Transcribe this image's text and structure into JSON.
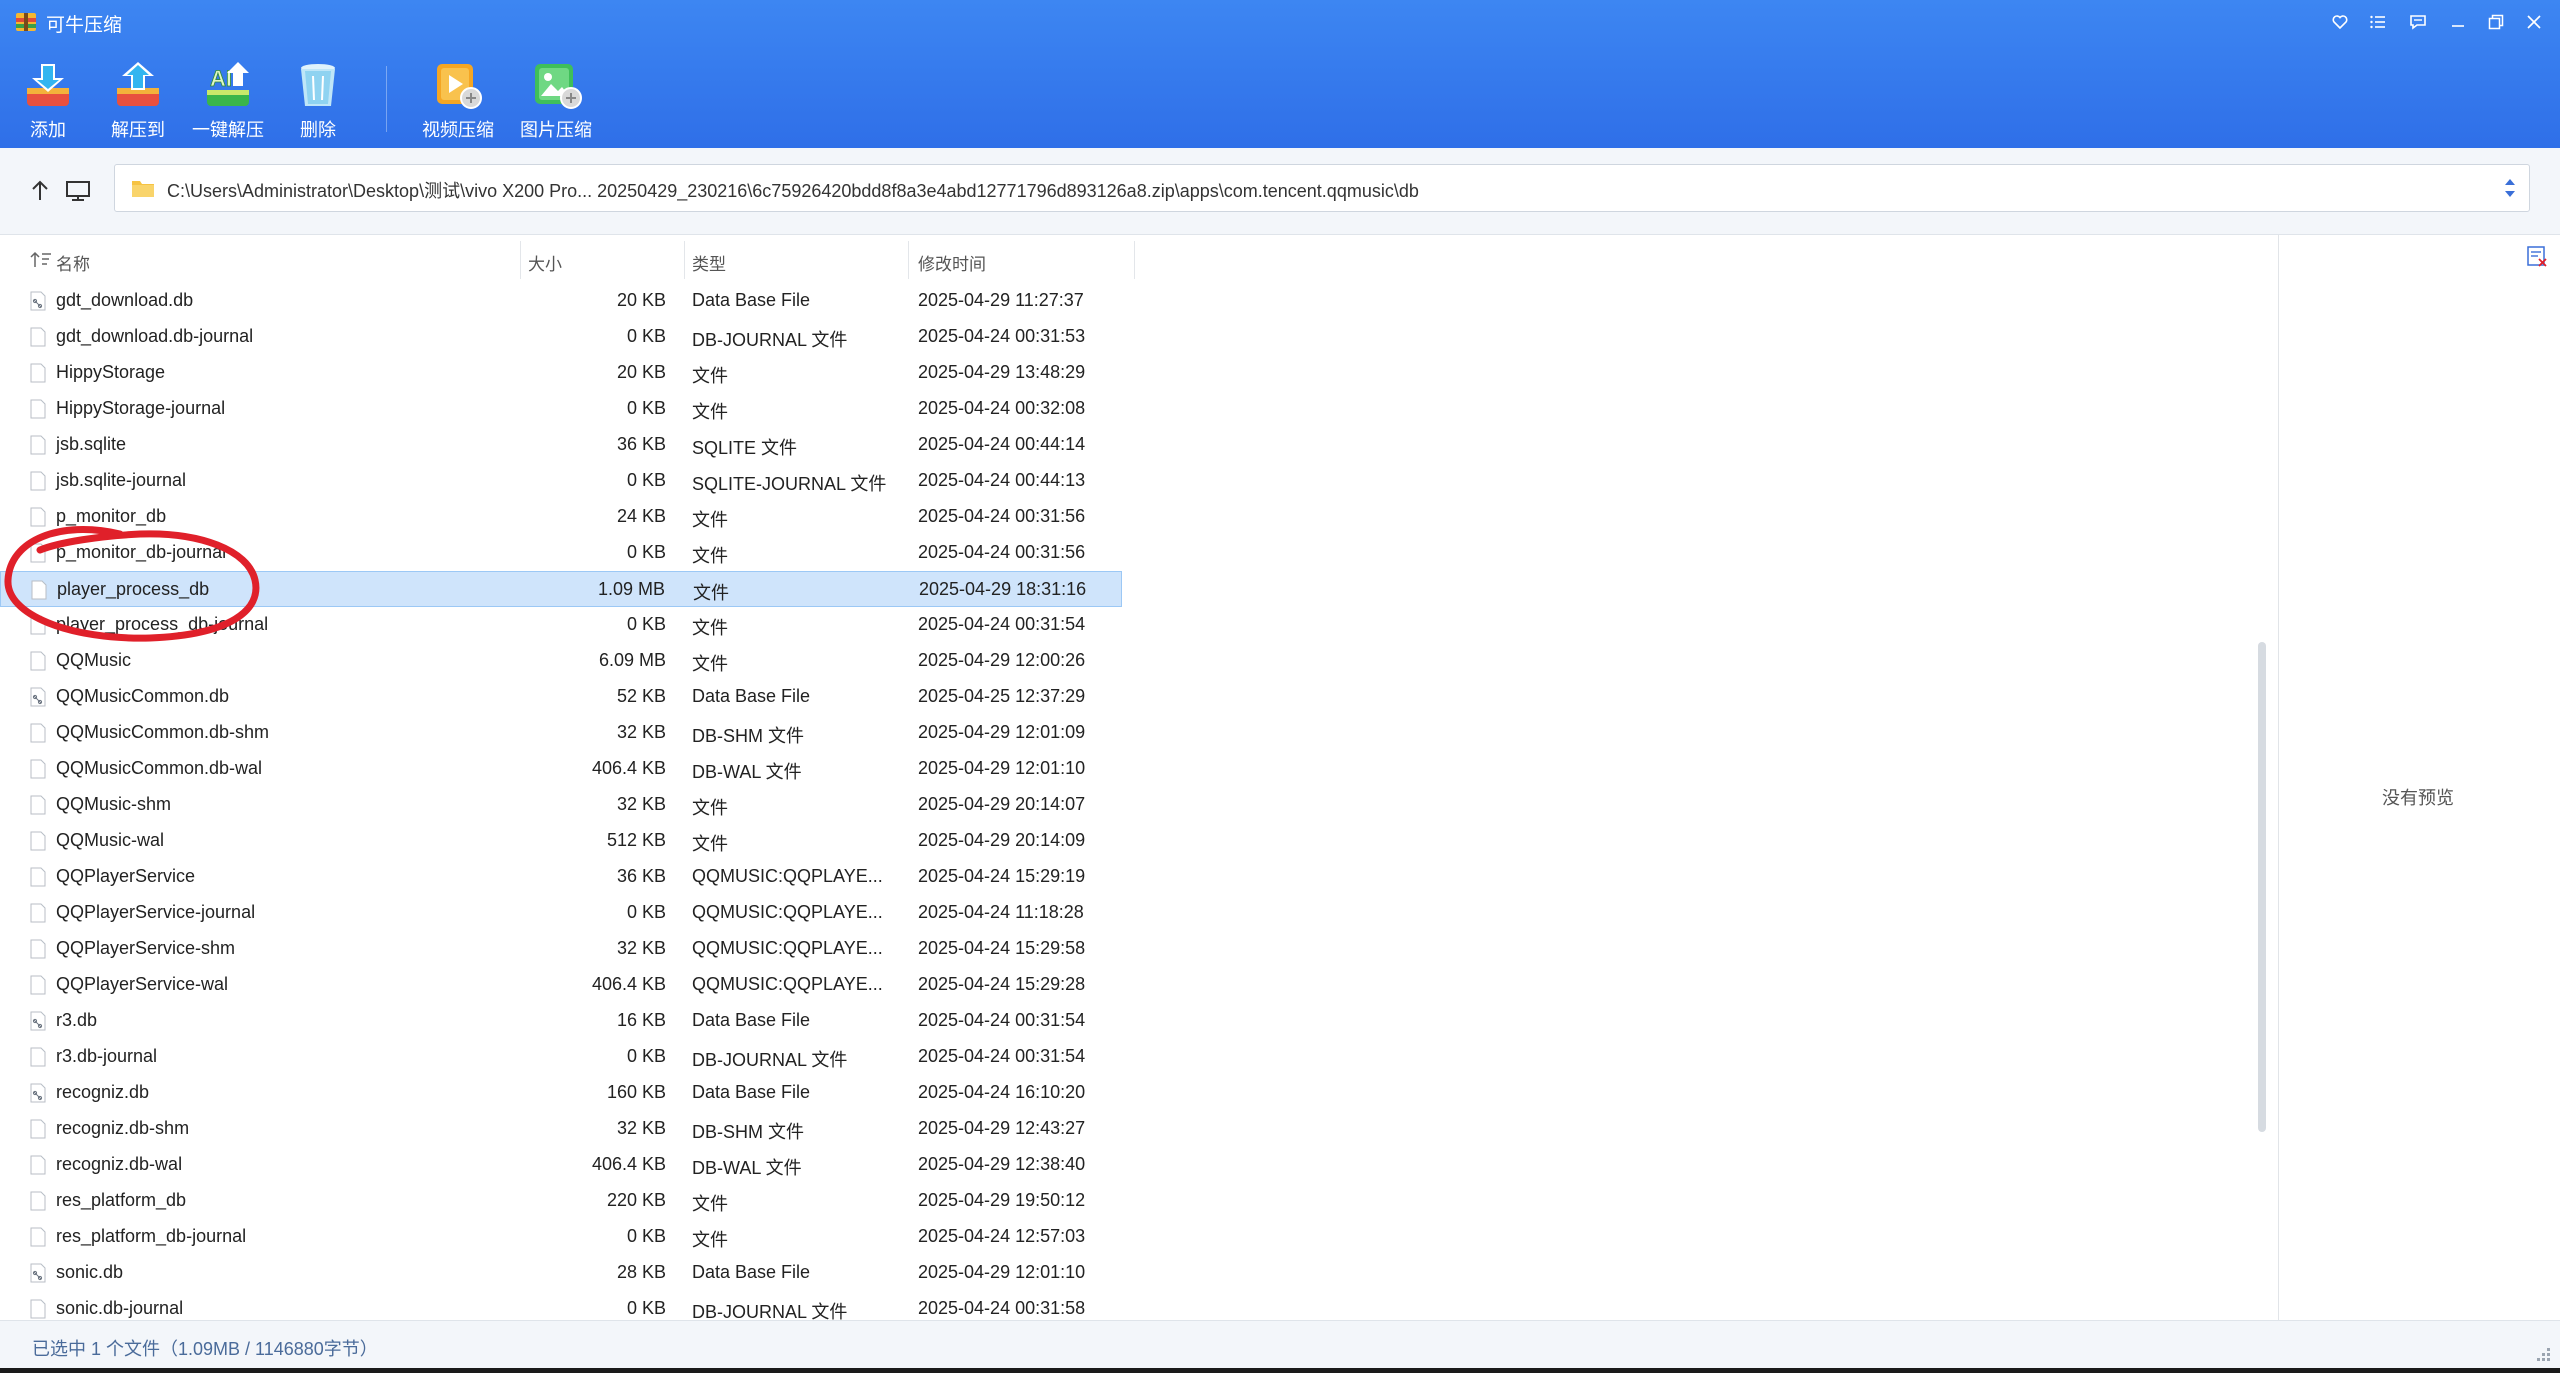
{
  "window": {
    "title": "可牛压缩"
  },
  "toolbar": {
    "buttons": [
      {
        "label": "添加",
        "icon": "add-icon"
      },
      {
        "label": "解压到",
        "icon": "extract-to-icon"
      },
      {
        "label": "一键解压",
        "icon": "one-click-extract-icon"
      },
      {
        "label": "删除",
        "icon": "delete-icon"
      },
      {
        "label": "视频压缩",
        "icon": "video-compress-icon"
      },
      {
        "label": "图片压缩",
        "icon": "image-compress-icon"
      }
    ]
  },
  "address": {
    "path": "C:\\Users\\Administrator\\Desktop\\测试\\vivo X200 Pro... 20250429_230216\\6c75926420bdd8f8a3e4abd12771796d893126a8.zip\\apps\\com.tencent.qqmusic\\db"
  },
  "columns": {
    "name": "名称",
    "size": "大小",
    "type": "类型",
    "modified": "修改时间"
  },
  "files": [
    {
      "name": "gdt_download.db",
      "size": "20 KB",
      "type": "Data Base File",
      "modified": "2025-04-29 11:27:37",
      "db": true
    },
    {
      "name": "gdt_download.db-journal",
      "size": "0 KB",
      "type": "DB-JOURNAL 文件",
      "modified": "2025-04-24 00:31:53"
    },
    {
      "name": "HippyStorage",
      "size": "20 KB",
      "type": "文件",
      "modified": "2025-04-29 13:48:29"
    },
    {
      "name": "HippyStorage-journal",
      "size": "0 KB",
      "type": "文件",
      "modified": "2025-04-24 00:32:08"
    },
    {
      "name": "jsb.sqlite",
      "size": "36 KB",
      "type": "SQLITE 文件",
      "modified": "2025-04-24 00:44:14"
    },
    {
      "name": "jsb.sqlite-journal",
      "size": "0 KB",
      "type": "SQLITE-JOURNAL 文件",
      "modified": "2025-04-24 00:44:13"
    },
    {
      "name": "p_monitor_db",
      "size": "24 KB",
      "type": "文件",
      "modified": "2025-04-24 00:31:56"
    },
    {
      "name": "p_monitor_db-journal",
      "size": "0 KB",
      "type": "文件",
      "modified": "2025-04-24 00:31:56"
    },
    {
      "name": "player_process_db",
      "size": "1.09 MB",
      "type": "文件",
      "modified": "2025-04-29 18:31:16",
      "selected": true
    },
    {
      "name": "player_process_db-journal",
      "size": "0 KB",
      "type": "文件",
      "modified": "2025-04-24 00:31:54"
    },
    {
      "name": "QQMusic",
      "size": "6.09 MB",
      "type": "文件",
      "modified": "2025-04-29 12:00:26"
    },
    {
      "name": "QQMusicCommon.db",
      "size": "52 KB",
      "type": "Data Base File",
      "modified": "2025-04-25 12:37:29",
      "db": true
    },
    {
      "name": "QQMusicCommon.db-shm",
      "size": "32 KB",
      "type": "DB-SHM 文件",
      "modified": "2025-04-29 12:01:09"
    },
    {
      "name": "QQMusicCommon.db-wal",
      "size": "406.4 KB",
      "type": "DB-WAL 文件",
      "modified": "2025-04-29 12:01:10"
    },
    {
      "name": "QQMusic-shm",
      "size": "32 KB",
      "type": "文件",
      "modified": "2025-04-29 20:14:07"
    },
    {
      "name": "QQMusic-wal",
      "size": "512 KB",
      "type": "文件",
      "modified": "2025-04-29 20:14:09"
    },
    {
      "name": "QQPlayerService",
      "size": "36 KB",
      "type": "QQMUSIC:QQPLAYE...",
      "modified": "2025-04-24 15:29:19"
    },
    {
      "name": "QQPlayerService-journal",
      "size": "0 KB",
      "type": "QQMUSIC:QQPLAYE...",
      "modified": "2025-04-24 11:18:28"
    },
    {
      "name": "QQPlayerService-shm",
      "size": "32 KB",
      "type": "QQMUSIC:QQPLAYE...",
      "modified": "2025-04-24 15:29:58"
    },
    {
      "name": "QQPlayerService-wal",
      "size": "406.4 KB",
      "type": "QQMUSIC:QQPLAYE...",
      "modified": "2025-04-24 15:29:28"
    },
    {
      "name": "r3.db",
      "size": "16 KB",
      "type": "Data Base File",
      "modified": "2025-04-24 00:31:54",
      "db": true
    },
    {
      "name": "r3.db-journal",
      "size": "0 KB",
      "type": "DB-JOURNAL 文件",
      "modified": "2025-04-24 00:31:54"
    },
    {
      "name": "recogniz.db",
      "size": "160 KB",
      "type": "Data Base File",
      "modified": "2025-04-24 16:10:20",
      "db": true
    },
    {
      "name": "recogniz.db-shm",
      "size": "32 KB",
      "type": "DB-SHM 文件",
      "modified": "2025-04-29 12:43:27"
    },
    {
      "name": "recogniz.db-wal",
      "size": "406.4 KB",
      "type": "DB-WAL 文件",
      "modified": "2025-04-29 12:38:40"
    },
    {
      "name": "res_platform_db",
      "size": "220 KB",
      "type": "文件",
      "modified": "2025-04-29 19:50:12"
    },
    {
      "name": "res_platform_db-journal",
      "size": "0 KB",
      "type": "文件",
      "modified": "2025-04-24 12:57:03"
    },
    {
      "name": "sonic.db",
      "size": "28 KB",
      "type": "Data Base File",
      "modified": "2025-04-29 12:01:10",
      "db": true
    },
    {
      "name": "sonic.db-journal",
      "size": "0 KB",
      "type": "DB-JOURNAL 文件",
      "modified": "2025-04-24 00:31:58"
    }
  ],
  "preview": {
    "empty_text": "没有预览"
  },
  "status": {
    "text": "已选中 1 个文件（1.09MB / 1146880字节）"
  },
  "colors": {
    "toolbar_bg": "#2f6fe8",
    "selection_bg": "#cfe4fb",
    "annotation": "#e0202a"
  }
}
